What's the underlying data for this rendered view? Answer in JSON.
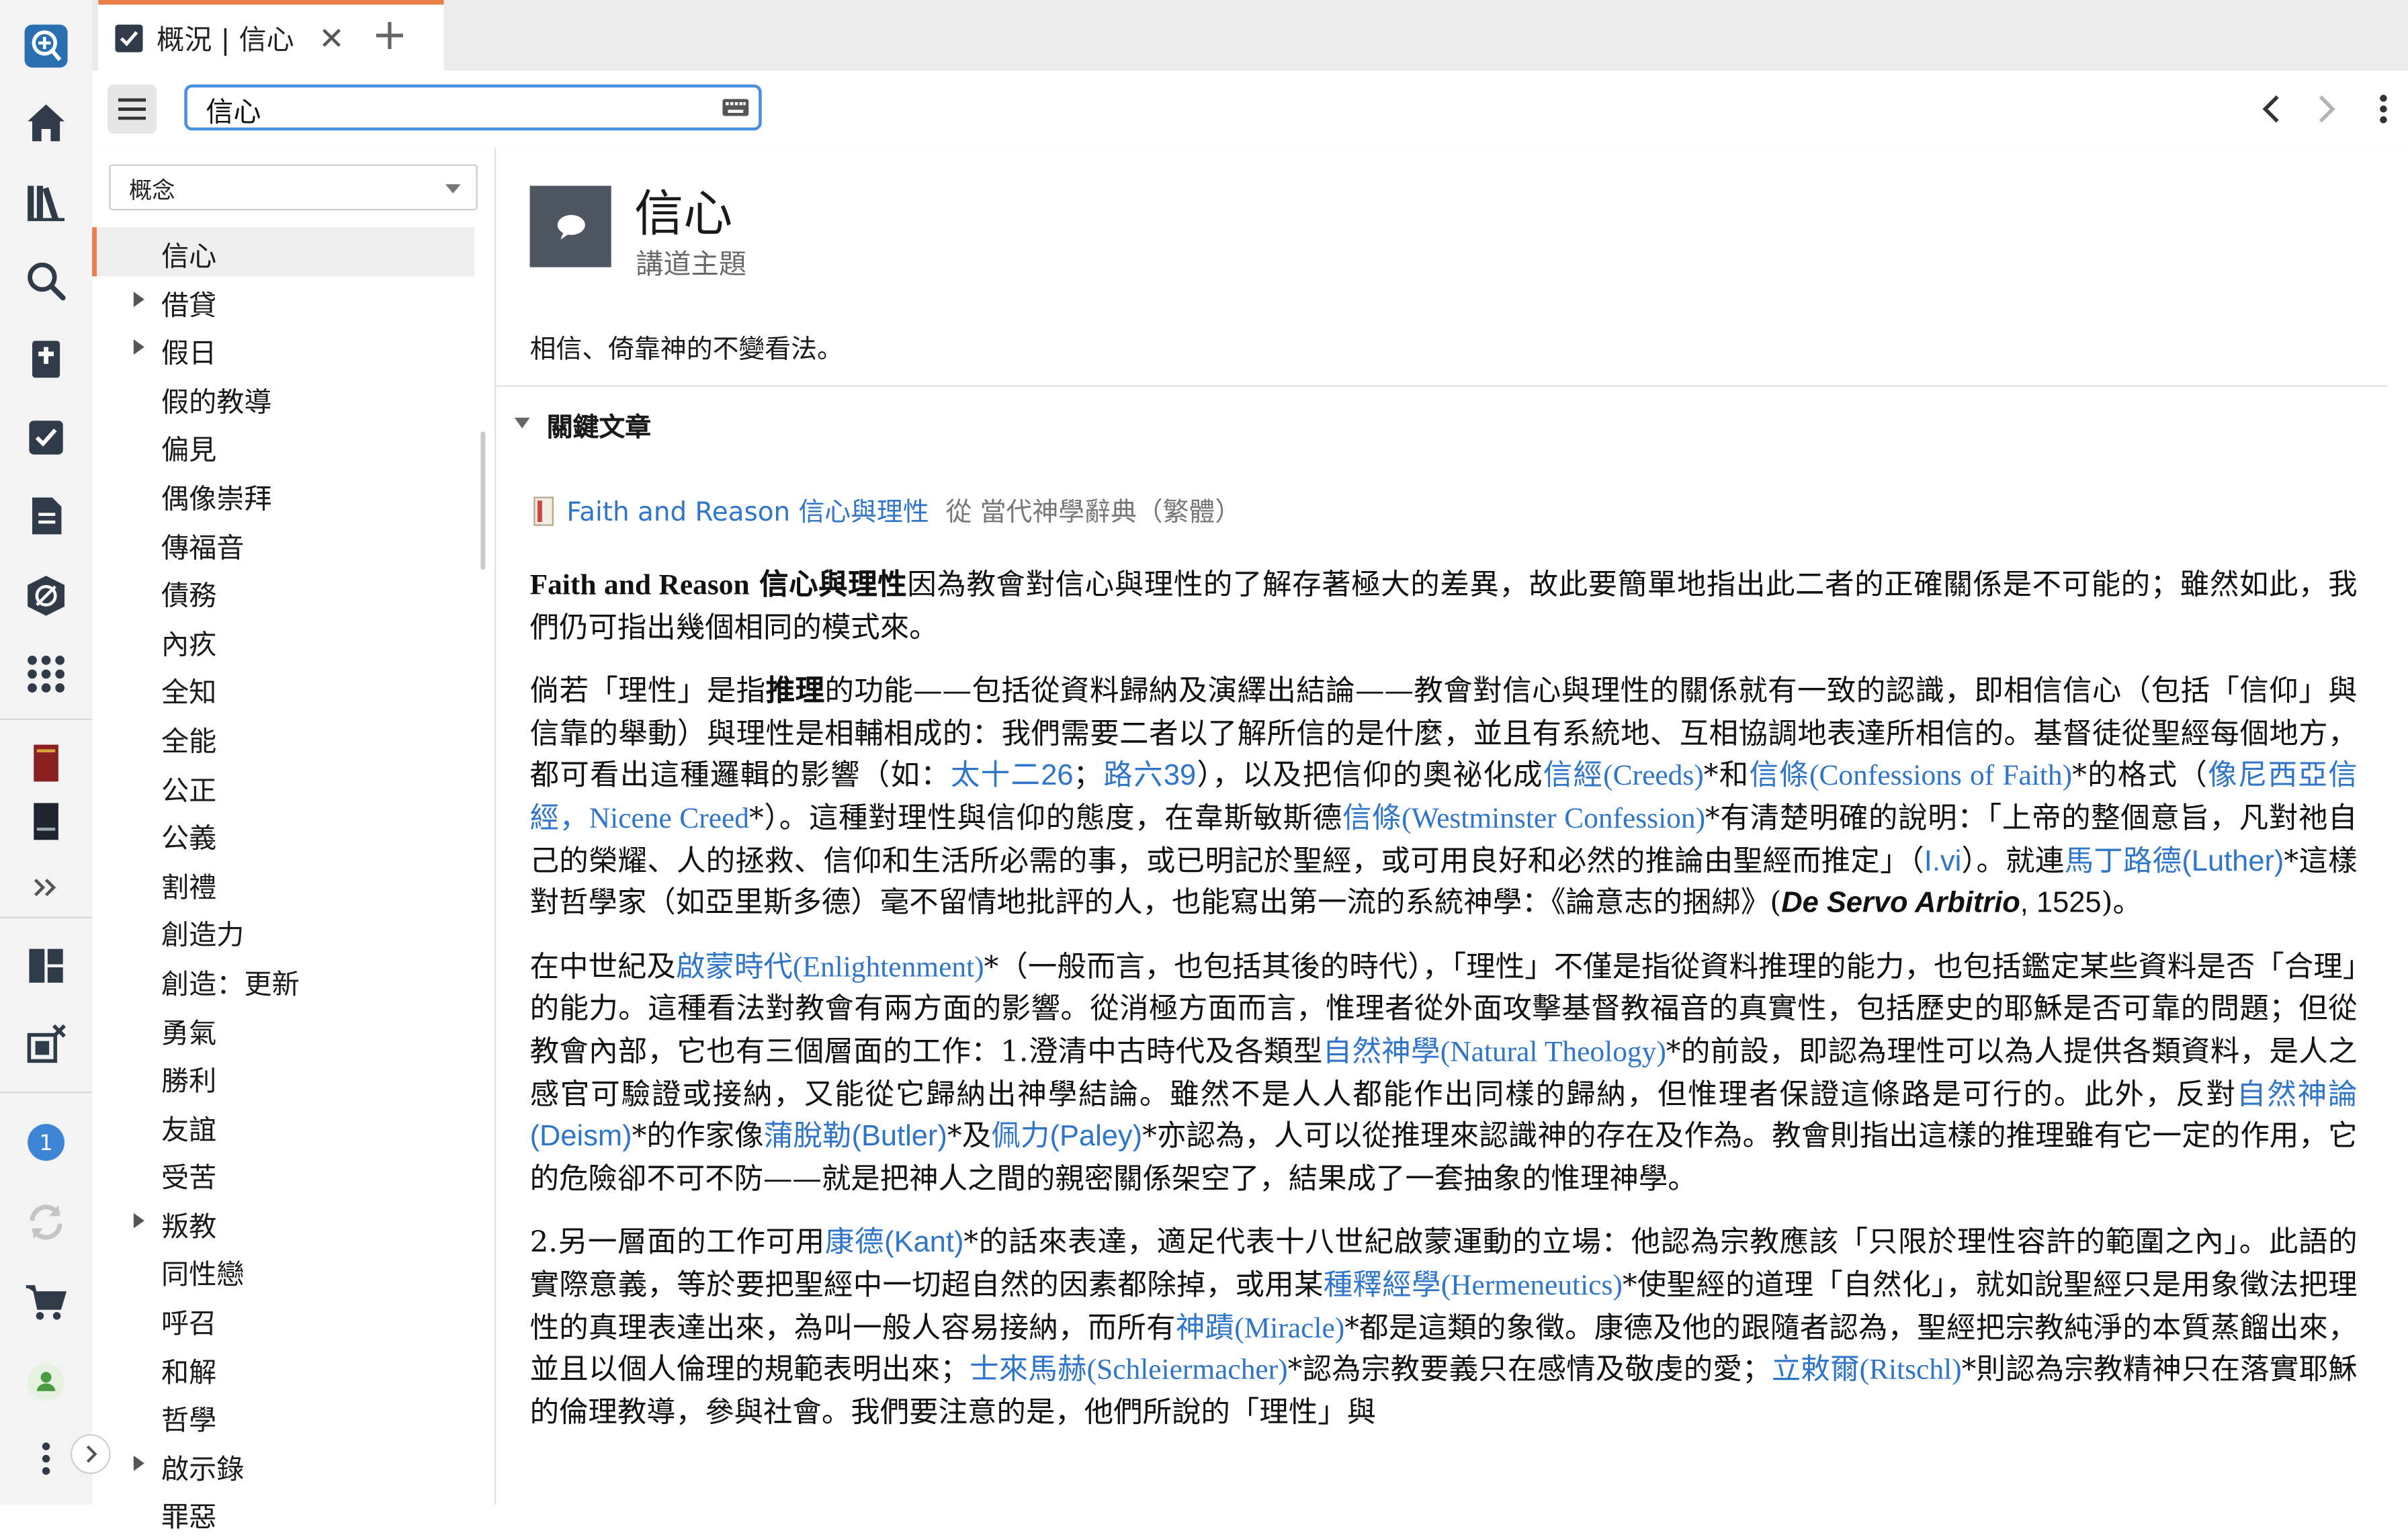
{
  "tab": {
    "title": "概況 | 信心",
    "close": "✕",
    "new": "+"
  },
  "search": {
    "value": "信心"
  },
  "sidebar": {
    "dropdown": "概念",
    "items": [
      {
        "label": "信心",
        "expandable": false,
        "selected": true
      },
      {
        "label": "借貸",
        "expandable": true
      },
      {
        "label": "假日",
        "expandable": true
      },
      {
        "label": "假的教導",
        "expandable": false
      },
      {
        "label": "偏見",
        "expandable": false
      },
      {
        "label": "偶像崇拜",
        "expandable": false
      },
      {
        "label": "傳福音",
        "expandable": false
      },
      {
        "label": "債務",
        "expandable": false
      },
      {
        "label": "內疚",
        "expandable": false
      },
      {
        "label": "全知",
        "expandable": false
      },
      {
        "label": "全能",
        "expandable": false
      },
      {
        "label": "公正",
        "expandable": false
      },
      {
        "label": "公義",
        "expandable": false
      },
      {
        "label": "割禮",
        "expandable": false
      },
      {
        "label": "創造力",
        "expandable": false
      },
      {
        "label": "創造：更新",
        "expandable": false
      },
      {
        "label": "勇氣",
        "expandable": false
      },
      {
        "label": "勝利",
        "expandable": false
      },
      {
        "label": "友誼",
        "expandable": false
      },
      {
        "label": "受苦",
        "expandable": false
      },
      {
        "label": "叛教",
        "expandable": true
      },
      {
        "label": "同性戀",
        "expandable": false
      },
      {
        "label": "呼召",
        "expandable": false
      },
      {
        "label": "和解",
        "expandable": false
      },
      {
        "label": "哲學",
        "expandable": false
      },
      {
        "label": "啟示錄",
        "expandable": true
      },
      {
        "label": "罪惡",
        "expandable": false
      }
    ]
  },
  "topic": {
    "title": "信心",
    "subtitle": "講道主題",
    "definition": "相信、倚靠神的不變看法。"
  },
  "section": {
    "title": "關鍵文章"
  },
  "source": {
    "link": "Faith and Reason 信心與理性",
    "from": "從 當代神學辭典（繁體）"
  },
  "rail": {
    "badge": "1"
  },
  "colors": {
    "accent": "#e8804a",
    "link": "#2f75c9",
    "rail_blue": "#2a6fb0"
  },
  "icons": [
    "logos-icon",
    "home-icon",
    "library-icon",
    "search-icon",
    "bible-icon",
    "checklist-icon",
    "document-icon",
    "guide-icon",
    "apps-icon",
    "book-red-icon",
    "book-dark-icon",
    "more-icon",
    "layout-icon",
    "close-panels-icon",
    "notification-icon",
    "sync-icon",
    "cart-icon",
    "user-icon",
    "kebab-icon"
  ]
}
